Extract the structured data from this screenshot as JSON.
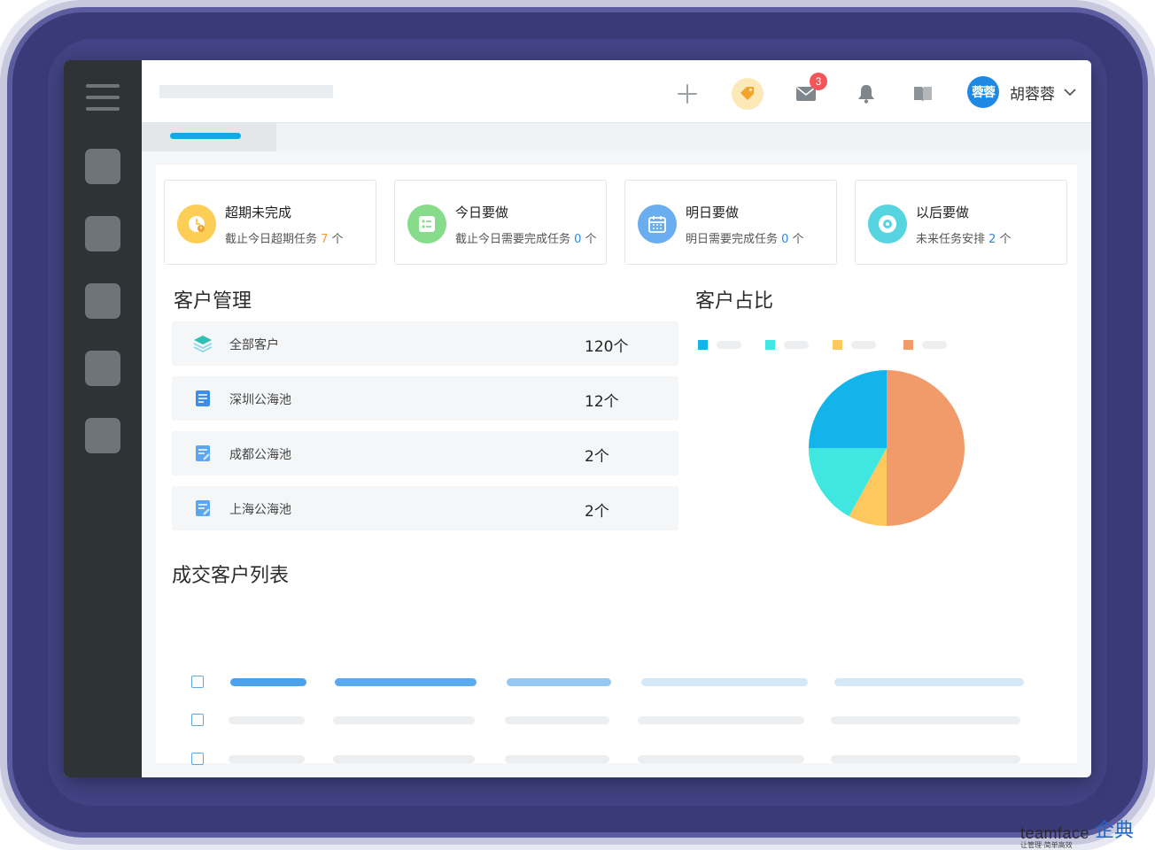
{
  "header": {
    "badge_count": "3",
    "user": {
      "avatar_text": "蓉蓉",
      "name": "胡蓉蓉"
    }
  },
  "task_cards": [
    {
      "title": "超期未完成",
      "prefix": "截止今日超期任务 ",
      "count": "7",
      "suffix": " 个",
      "count_color": "#f29b38",
      "icon": "clock-icon",
      "icon_bg": "#fcce55"
    },
    {
      "title": "今日要做",
      "prefix": "截止今日需要完成任务 ",
      "count": "0",
      "suffix": " 个",
      "count_color": "#2e86e6",
      "icon": "checklist-icon",
      "icon_bg": "#86dc8a"
    },
    {
      "title": "明日要做",
      "prefix": "明日需要完成任务 ",
      "count": "0",
      "suffix": " 个",
      "count_color": "#2e86e6",
      "icon": "calendar-icon",
      "icon_bg": "#6aaef0"
    },
    {
      "title": "以后要做",
      "prefix": "未来任务安排 ",
      "count": "2",
      "suffix": " 个",
      "count_color": "#2e86e6",
      "icon": "target-icon",
      "icon_bg": "#56d4e0"
    }
  ],
  "customer_management": {
    "title": "客户管理",
    "rows": [
      {
        "label": "全部客户",
        "value": "120个",
        "icon": "layers-icon"
      },
      {
        "label": "深圳公海池",
        "value": "12个",
        "icon": "document-icon"
      },
      {
        "label": "成都公海池",
        "value": "2个",
        "icon": "document-edit-icon"
      },
      {
        "label": "上海公海池",
        "value": "2个",
        "icon": "document-edit-icon"
      }
    ]
  },
  "customer_ratio": {
    "title": "客户占比"
  },
  "chart_data": {
    "type": "pie",
    "slices": [
      {
        "value": 50,
        "color": "#f29b6a"
      },
      {
        "value": 8,
        "color": "#fdc95f"
      },
      {
        "value": 17,
        "color": "#40e6e0"
      },
      {
        "value": 25,
        "color": "#12b4ea"
      }
    ],
    "legend_colors": [
      "#12b4ea",
      "#40e6e0",
      "#fdc95f",
      "#f29b6a"
    ]
  },
  "deal_list": {
    "title": "成交客户列表"
  },
  "watermark": {
    "brand": "teamface",
    "cn": "企典",
    "tagline": "让管理·简单高效"
  }
}
